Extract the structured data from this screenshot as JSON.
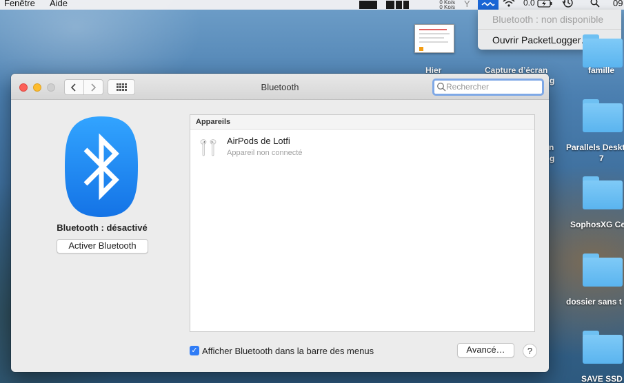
{
  "menubar": {
    "items": [
      "Fenêtre",
      "Aide"
    ],
    "network_up": "0 Ko/s",
    "network_down": "0 Ko/s",
    "battery_value": "0.0",
    "clock_partial": "09"
  },
  "bt_menu": {
    "status": "Bluetooth : non disponible",
    "packetlogger": "Ouvrir PacketLogger…"
  },
  "desktop": {
    "items": [
      {
        "label": "Hier"
      },
      {
        "label": "Capture d’écran"
      },
      {
        "label": "g"
      },
      {
        "label": "famille"
      },
      {
        "label": "n"
      },
      {
        "label": "g"
      },
      {
        "label": "Parallels Deskt"
      },
      {
        "label": "7"
      },
      {
        "label": "SophosXG Ce"
      },
      {
        "label": "dossier sans t"
      },
      {
        "label": "SAVE SSD"
      }
    ]
  },
  "window": {
    "title": "Bluetooth",
    "search_placeholder": "Rechercher",
    "bluetooth_status": "Bluetooth : désactivé",
    "activate_button": "Activer Bluetooth",
    "devices_header": "Appareils",
    "devices": [
      {
        "name": "AirPods de Lotfi",
        "status": "Appareil non connecté"
      }
    ],
    "show_in_menubar_label": "Afficher Bluetooth dans la barre des menus",
    "show_in_menubar_checked": true,
    "checkmark": "✓",
    "advanced_button": "Avancé…",
    "help_button": "?"
  },
  "colors": {
    "accent": "#2f7cf6",
    "bluetooth_logo": "#1e8ef5",
    "tray_highlight": "#1a66d6"
  }
}
